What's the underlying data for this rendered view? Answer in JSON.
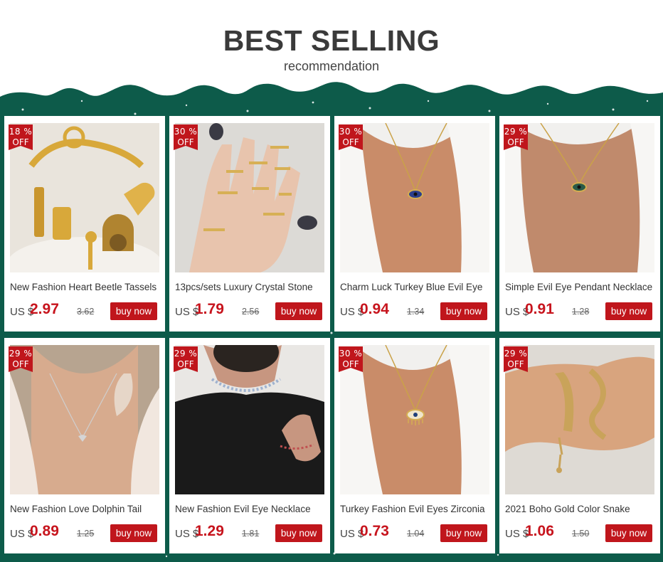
{
  "header": {
    "title": "BEST SELLING",
    "subtitle": "recommendation"
  },
  "colors": {
    "band": "#0d5b4a",
    "accent": "#c0161c",
    "price": "#c7141d"
  },
  "buy_label": "buy now",
  "products": [
    {
      "discount": "18 %",
      "off": "OFF",
      "name": "New Fashion Heart Beetle Tassels",
      "currency": "US $",
      "price": "2.97",
      "old_price": "3.62",
      "image": "gold-charm-bracelet"
    },
    {
      "discount": "30 %",
      "off": "OFF",
      "name": "13pcs/sets Luxury Crystal Stone",
      "currency": "US $",
      "price": "1.79",
      "old_price": "2.56",
      "image": "ring-set-on-hand"
    },
    {
      "discount": "30 %",
      "off": "OFF",
      "name": "Charm Luck Turkey Blue Evil Eye",
      "currency": "US $",
      "price": "0.94",
      "old_price": "1.34",
      "image": "evil-eye-necklace"
    },
    {
      "discount": "29 %",
      "off": "OFF",
      "name": "Simple Evil Eye Pendant Necklace",
      "currency": "US $",
      "price": "0.91",
      "old_price": "1.28",
      "image": "evil-eye-pendant"
    },
    {
      "discount": "29 %",
      "off": "OFF",
      "name": "New Fashion Love Dolphin Tail",
      "currency": "US $",
      "price": "0.89",
      "old_price": "1.25",
      "image": "dolphin-tail-necklace"
    },
    {
      "discount": "29 %",
      "off": "OFF",
      "name": "New Fashion Evil Eye Necklace",
      "currency": "US $",
      "price": "1.29",
      "old_price": "1.81",
      "image": "beaded-eye-necklace"
    },
    {
      "discount": "30 %",
      "off": "OFF",
      "name": "Turkey Fashion Evil Eyes Zirconia",
      "currency": "US $",
      "price": "0.73",
      "old_price": "1.04",
      "image": "zirconia-eye-necklace"
    },
    {
      "discount": "29 %",
      "off": "OFF",
      "name": "2021 Boho Gold Color Snake",
      "currency": "US $",
      "price": "1.06",
      "old_price": "1.50",
      "image": "snake-bracelet"
    }
  ]
}
